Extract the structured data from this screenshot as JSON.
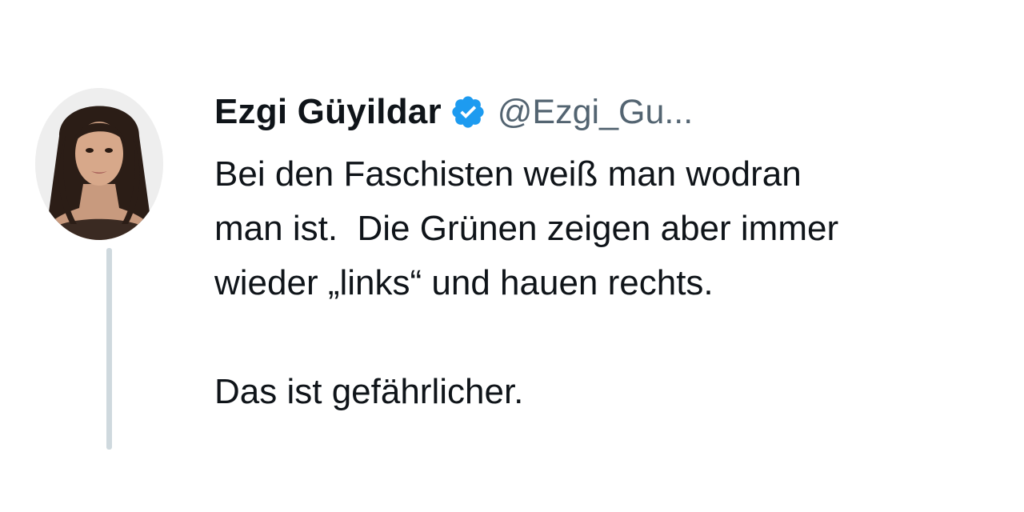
{
  "tweet": {
    "author": {
      "display_name": "Ezgi Güyildar",
      "handle": "@Ezgi_Gu...",
      "verified": true,
      "avatar": "profile-photo"
    },
    "text_lines": [
      "Bei den Faschisten weiß man wodran",
      "man ist.  Die Grünen zeigen aber immer",
      "wieder „links“ und hauen rechts.",
      "",
      "Das ist gefährlicher."
    ]
  },
  "colors": {
    "text": "#0f1419",
    "handle": "#536471",
    "verified_badge": "#1d9bf0",
    "thread_line": "#cfd9de",
    "background": "#ffffff"
  }
}
